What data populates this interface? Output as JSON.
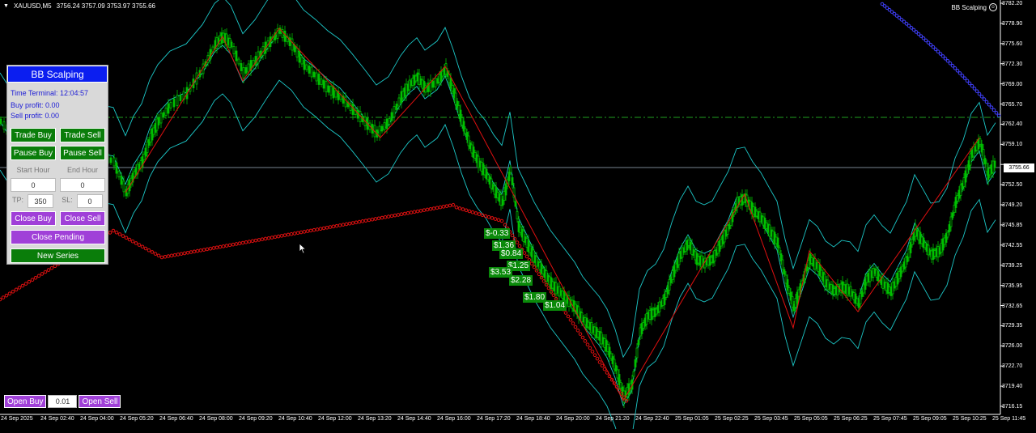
{
  "header": {
    "symbol": "XAUUSD,M5",
    "ohlc": "3756.24 3757.09 3753.97 3755.66"
  },
  "ea_name": "BB Scalping",
  "y_axis": [
    "3782.20",
    "3778.90",
    "3775.60",
    "3772.30",
    "3769.00",
    "3765.70",
    "3762.40",
    "3759.10",
    "3755.66",
    "3752.50",
    "3749.20",
    "3745.85",
    "3742.55",
    "3739.25",
    "3735.95",
    "3732.65",
    "3729.35",
    "3726.00",
    "3722.70",
    "3719.40",
    "3716.15"
  ],
  "x_axis": [
    "24 Sep 2025",
    "24 Sep 02:40",
    "24 Sep 04:00",
    "24 Sep 05:20",
    "24 Sep 06:40",
    "24 Sep 08:00",
    "24 Sep 09:20",
    "24 Sep 10:40",
    "24 Sep 12:00",
    "24 Sep 13:20",
    "24 Sep 14:40",
    "24 Sep 16:00",
    "24 Sep 17:20",
    "24 Sep 18:40",
    "24 Sep 20:00",
    "24 Sep 21:20",
    "24 Sep 22:40",
    "25 Sep 01:05",
    "25 Sep 02:25",
    "25 Sep 03:45",
    "25 Sep 05:05",
    "25 Sep 06:25",
    "25 Sep 07:45",
    "25 Sep 09:05",
    "25 Sep 10:25",
    "25 Sep 11:45"
  ],
  "current_price": "3755.66",
  "colors": {
    "bull": "#00c000",
    "bear": "#00c000",
    "bands": "#1cc8c8",
    "zigzag": "#e01010",
    "upper_dots": "#4040ff",
    "lower_dots": "#e01010",
    "hline": "#1a8a1a"
  },
  "panel": {
    "title": "BB Scalping",
    "time_label": "Time Terminal: 12:04:57",
    "buy_profit": "Buy profit: 0.00",
    "sell_profit": "Sell profit: 0.00",
    "trade_buy": "Trade Buy",
    "trade_sell": "Trade Sell",
    "pause_buy": "Pause Buy",
    "pause_sell": "Pause Sell",
    "start_hour_label": "Start Hour",
    "end_hour_label": "End Hour",
    "start_hour": "0",
    "end_hour": "0",
    "tp_label": "TP:",
    "tp_value": "350",
    "sl_label": "SL:",
    "sl_value": "0",
    "close_buy": "Close Buy",
    "close_sell": "Close Sell",
    "close_pending": "Close Pending",
    "new_series": "New Series"
  },
  "profits": [
    "$-0.33",
    "$1.36",
    "$0.84",
    "$1.25",
    "$3.53",
    "$2.28",
    "$1.80",
    "$1.04"
  ],
  "bottom": {
    "open_buy": "Open Buy",
    "lot": "0.01",
    "open_sell": "Open Sell"
  }
}
